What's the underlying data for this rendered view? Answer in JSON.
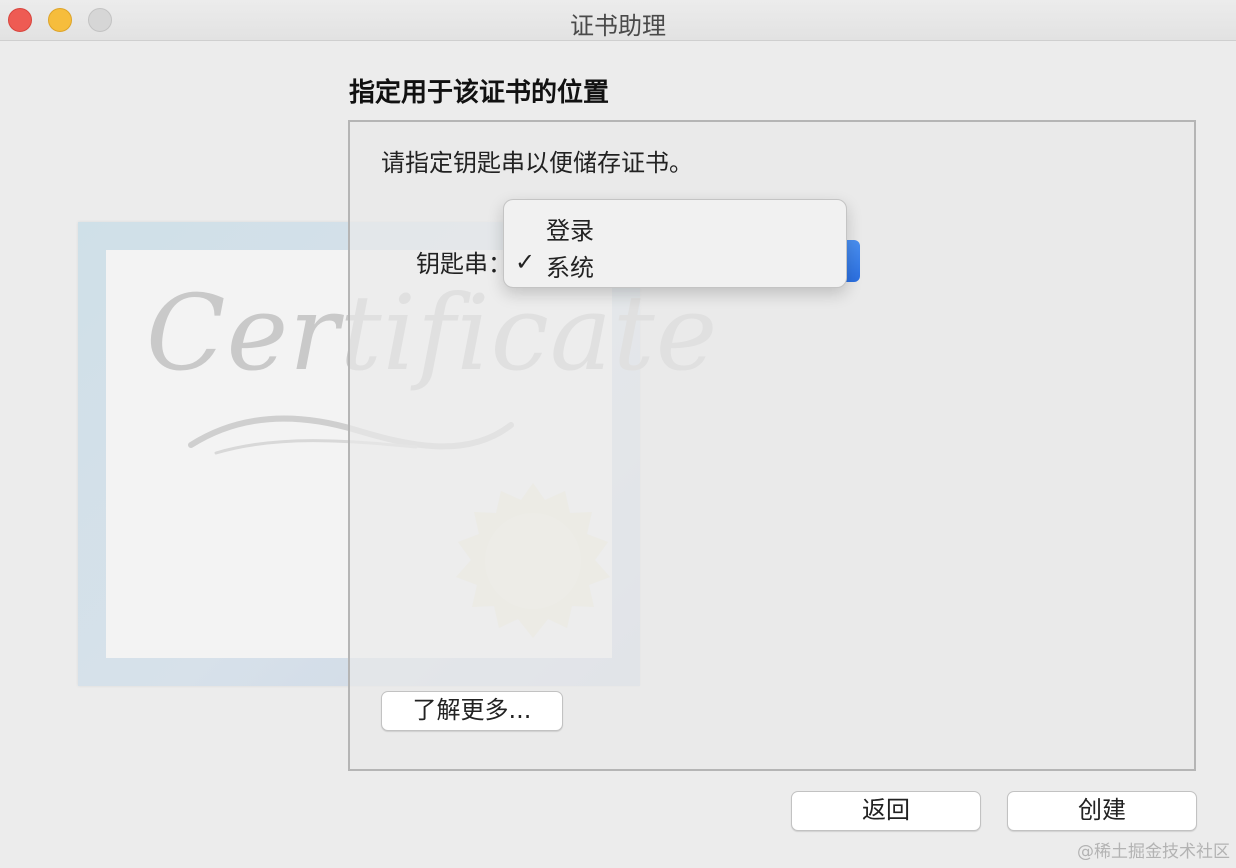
{
  "window": {
    "title": "证书助理"
  },
  "heading": "指定用于该证书的位置",
  "instruction": "请指定钥匙串以便储存证书。",
  "keychain": {
    "label": "钥匙串：",
    "menu_items": [
      {
        "label": "登录",
        "checked": false
      },
      {
        "label": "系统",
        "checked": true
      }
    ],
    "check_glyph": "✓"
  },
  "buttons": {
    "learn_more": "了解更多...",
    "back": "返回",
    "create": "创建"
  },
  "certificate_art": {
    "script_text": "Certificate"
  },
  "watermark": "@稀土掘金技术社区",
  "colors": {
    "close": "#ee5b53",
    "minimize": "#f6bd3c",
    "zoom_inactive": "#d6d6d6",
    "accent_blue": "#2b6fe0"
  }
}
